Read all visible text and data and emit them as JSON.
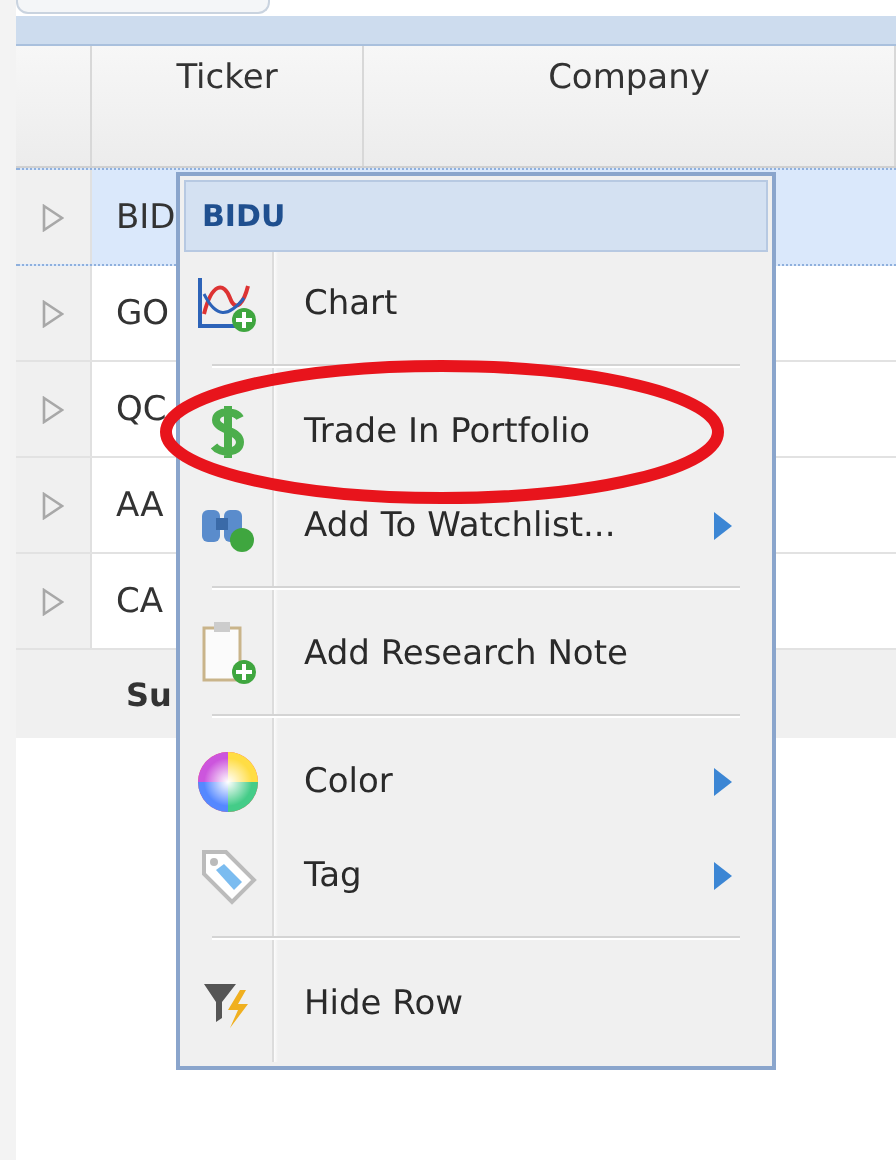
{
  "table": {
    "columns": [
      "Ticker",
      "Company"
    ],
    "rows": [
      {
        "ticker": "BID",
        "selected": true
      },
      {
        "ticker": "GO",
        "selected": false
      },
      {
        "ticker": "QC",
        "selected": false
      },
      {
        "ticker": "AA",
        "selected": false
      },
      {
        "ticker": "CA",
        "selected": false
      }
    ],
    "summary": "Su"
  },
  "context_menu": {
    "title": "BIDU",
    "sections": [
      [
        {
          "label": "Chart",
          "submenu": false
        }
      ],
      [
        {
          "label": "Trade In Portfolio",
          "submenu": false
        },
        {
          "label": "Add To Watchlist...",
          "submenu": true
        }
      ],
      [
        {
          "label": "Add Research Note",
          "submenu": false
        }
      ],
      [
        {
          "label": "Color",
          "submenu": true
        },
        {
          "label": "Tag",
          "submenu": true
        }
      ],
      [
        {
          "label": "Hide Row",
          "submenu": false
        }
      ]
    ]
  }
}
